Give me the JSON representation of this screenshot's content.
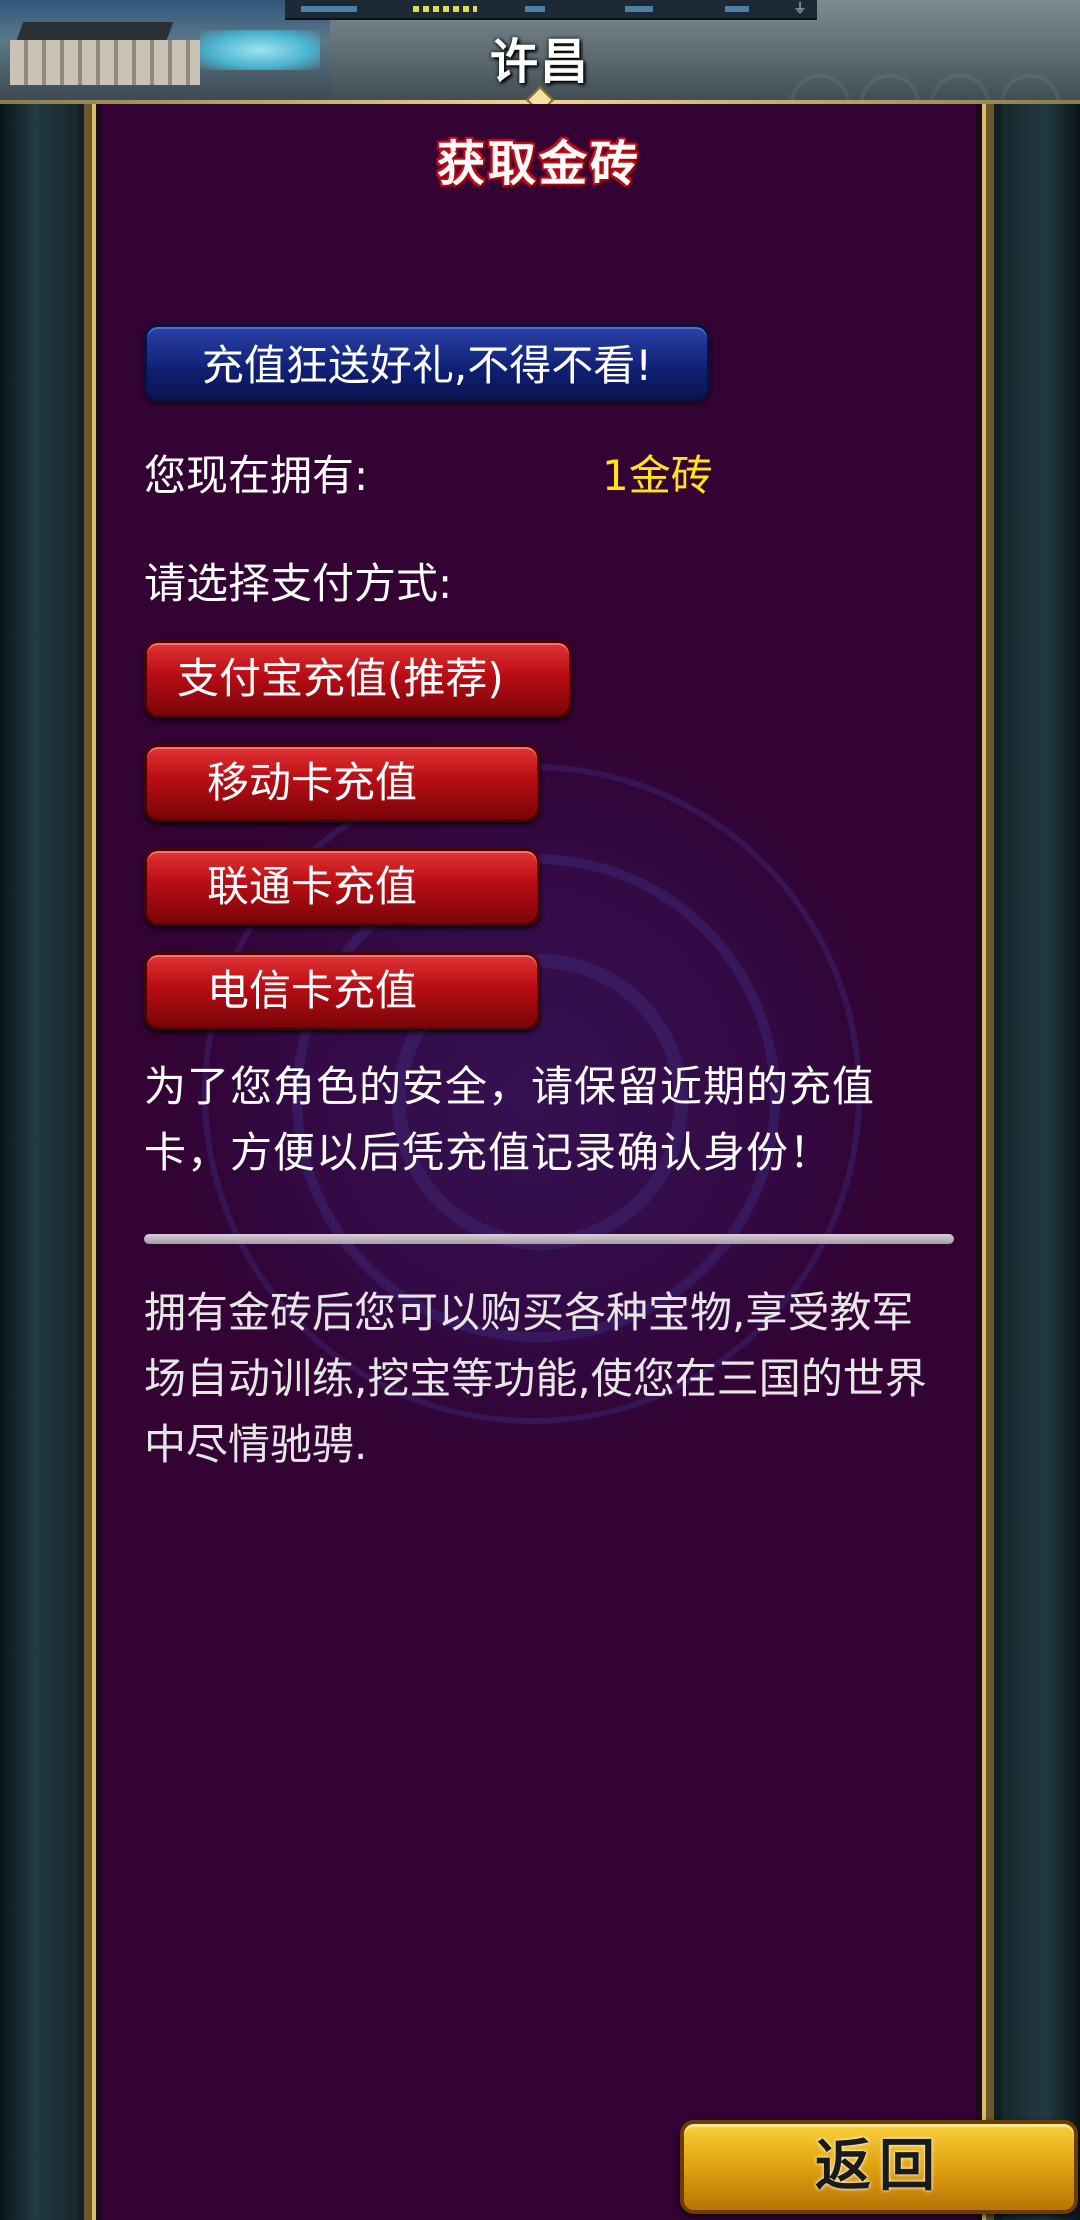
{
  "header": {
    "city_name": "许昌"
  },
  "panel": {
    "title": "获取金砖",
    "promo_button": "充值狂送好礼,不得不看!",
    "own_label": "您现在拥有:",
    "own_value": "1金砖",
    "choose_label": "请选择支付方式:",
    "payment_options": [
      "支付宝充值(推荐)",
      "移动卡充值",
      "联通卡充值",
      "电信卡充值"
    ],
    "safety_note": " 为了您角色的安全，请保留近期的充值卡，方便以后凭充值记录确认身份！",
    "benefits_text": " 拥有金砖后您可以购买各种宝物,享受教军场自动训练,挖宝等功能,使您在三国的世界中尽情驰骋."
  },
  "footer": {
    "back_button": "返回"
  },
  "colors": {
    "panel_bg": "#330334",
    "accent_gold": "#ffe21a",
    "pay_button_red": "#b80d15",
    "promo_button_blue": "#0f1f72",
    "back_button_gold": "#e3a512"
  },
  "icons": {
    "minimap_pin": "pin-icon"
  }
}
